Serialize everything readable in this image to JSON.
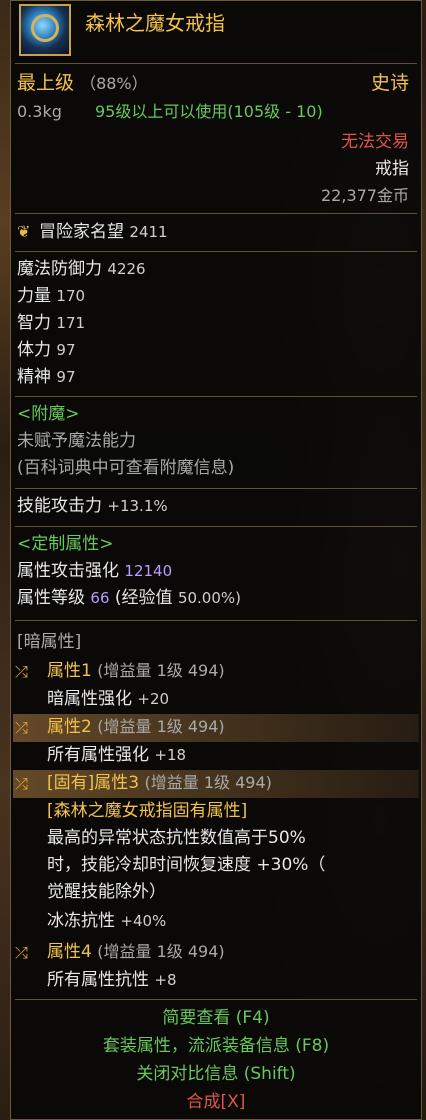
{
  "item": {
    "name": "森林之魔女戒指",
    "grade": "最上级",
    "grade_pct": "（88%）",
    "rarity": "史诗",
    "weight": "0.3kg",
    "level_req": "95级以上可以使用(105级 - 10)",
    "trade": "无法交易",
    "type": "戒指",
    "price": "22,377金币"
  },
  "fame": {
    "label": "冒险家名望",
    "value": "2411"
  },
  "stats": [
    {
      "label": "魔法防御力",
      "value": "4226"
    },
    {
      "label": "力量",
      "value": "170"
    },
    {
      "label": "智力",
      "value": "171"
    },
    {
      "label": "体力",
      "value": "97"
    },
    {
      "label": "精神",
      "value": "97"
    }
  ],
  "enchant": {
    "header": "<附魔>",
    "line1": "未赋予魔法能力",
    "line2": "(百科词典中可查看附魔信息)"
  },
  "skill_attack": {
    "label": "技能攻击力",
    "value": "+13.1%"
  },
  "custom": {
    "header": "<定制属性>",
    "elem_attack_label": "属性攻击强化",
    "elem_attack_value": "12140",
    "elem_level_label": "属性等级",
    "elem_level_value": "66",
    "exp_label": "(经验值",
    "exp_value": "50.00%)"
  },
  "dark": {
    "header": "[暗属性]"
  },
  "attrs": [
    {
      "title": "属性1",
      "sub": "(增益量 1级 494)",
      "effect_label": "暗属性强化",
      "effect_value": "+20"
    },
    {
      "title": "属性2",
      "sub": "(增益量 1级 494)",
      "effect_label": "所有属性强化",
      "effect_value": "+18"
    },
    {
      "title": "[固有]属性3",
      "sub": "(增益量 1级 494)"
    },
    {
      "title": "属性4",
      "sub": "(增益量 1级 494)",
      "effect_label": "所有属性抗性",
      "effect_value": "+8"
    }
  ],
  "inherent": {
    "title": "[森林之魔女戒指固有属性]",
    "line1": "最高的异常状态抗性数值高于50%",
    "line2": "时，技能冷却时间恢复速度 +30%（",
    "line3": "觉醒技能除外）",
    "line4_label": "冰冻抗性",
    "line4_value": "+40%"
  },
  "footer": {
    "brief": "简要查看 (F4)",
    "set": "套装属性，流派装备信息 (F8)",
    "compare": "关闭对比信息 (Shift)",
    "craft": "合成[X]"
  }
}
